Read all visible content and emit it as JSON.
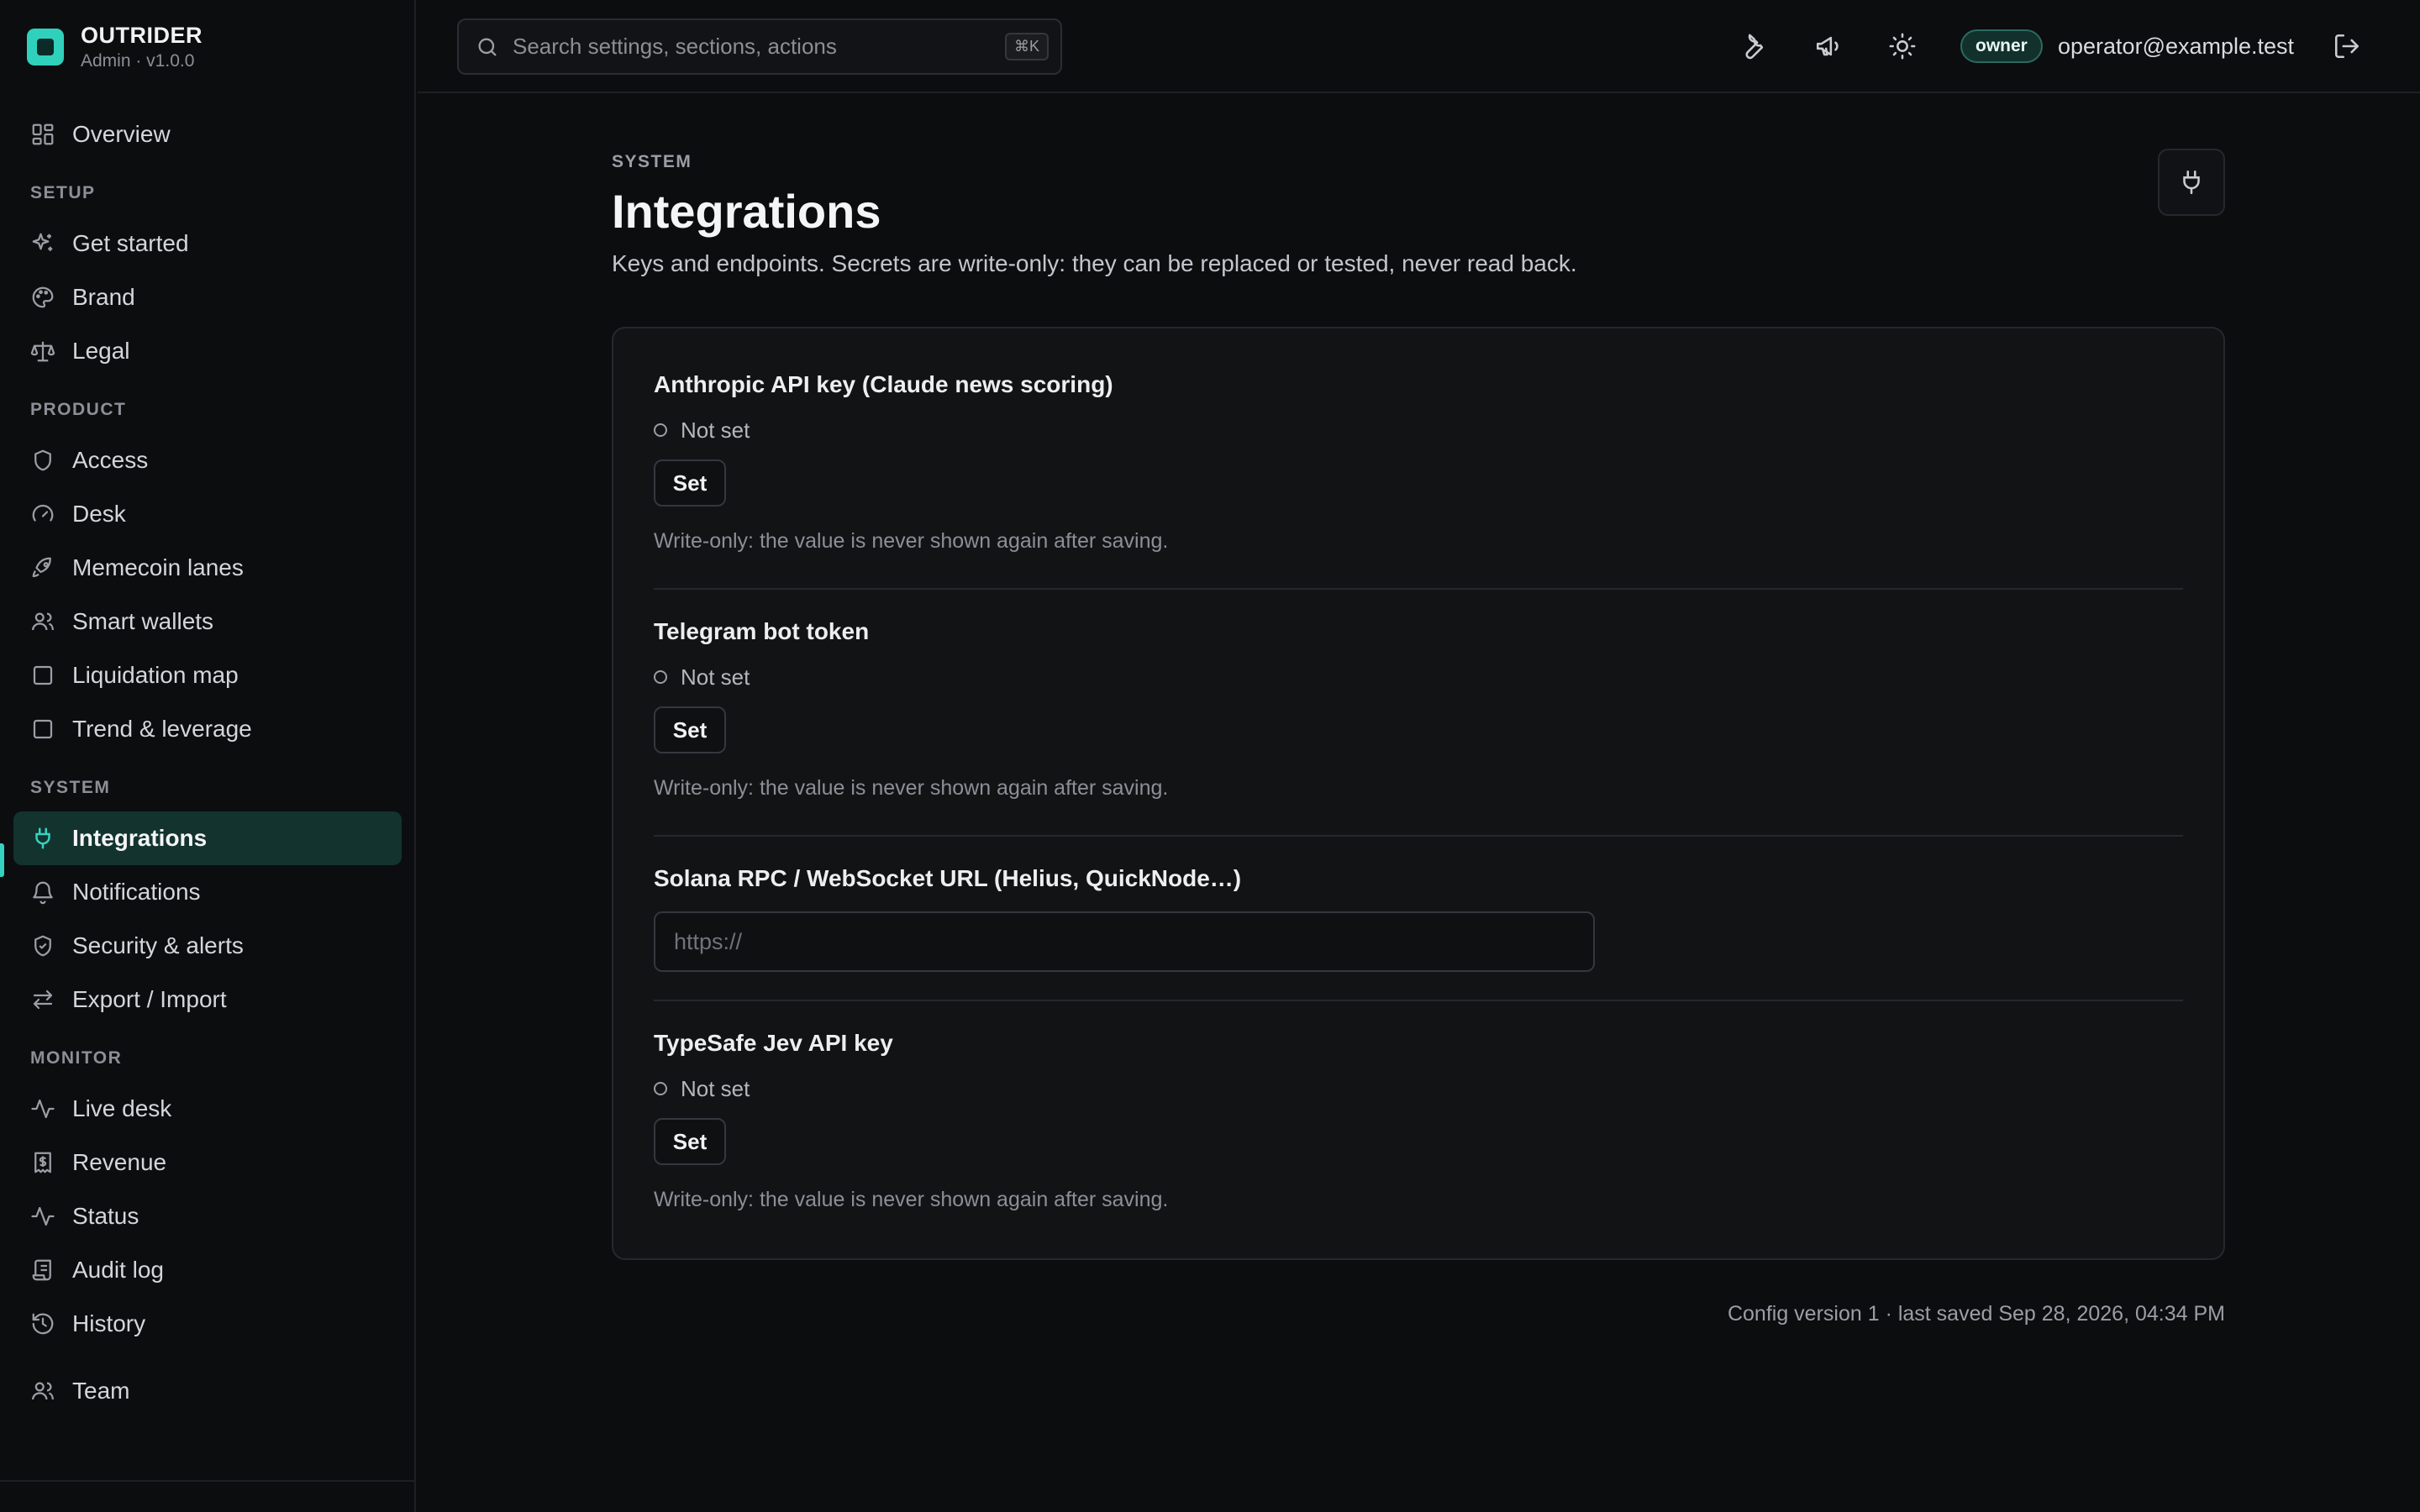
{
  "app": {
    "name": "OUTRIDER",
    "subtitle": "Admin · v1.0.0",
    "accent": "#35d3bf"
  },
  "sidebar": {
    "overview": "Overview",
    "groups": [
      {
        "label": "SETUP",
        "items": [
          {
            "label": "Get started",
            "icon": "sparkles-icon"
          },
          {
            "label": "Brand",
            "icon": "palette-icon"
          },
          {
            "label": "Legal",
            "icon": "scale-icon"
          }
        ]
      },
      {
        "label": "PRODUCT",
        "items": [
          {
            "label": "Access",
            "icon": "shield-icon"
          },
          {
            "label": "Desk",
            "icon": "gauge-icon"
          },
          {
            "label": "Memecoin lanes",
            "icon": "rocket-icon"
          },
          {
            "label": "Smart wallets",
            "icon": "users-icon"
          },
          {
            "label": "Liquidation map",
            "icon": "square-icon"
          },
          {
            "label": "Trend & leverage",
            "icon": "square-icon"
          }
        ]
      },
      {
        "label": "SYSTEM",
        "items": [
          {
            "label": "Integrations",
            "icon": "plug-icon",
            "active": true
          },
          {
            "label": "Notifications",
            "icon": "bell-icon"
          },
          {
            "label": "Security & alerts",
            "icon": "shield-check-icon"
          },
          {
            "label": "Export / Import",
            "icon": "arrows-swap-icon"
          }
        ]
      },
      {
        "label": "MONITOR",
        "items": [
          {
            "label": "Live desk",
            "icon": "activity-icon"
          },
          {
            "label": "Revenue",
            "icon": "receipt-icon"
          },
          {
            "label": "Status",
            "icon": "activity-icon"
          },
          {
            "label": "Audit log",
            "icon": "scroll-icon"
          },
          {
            "label": "History",
            "icon": "history-icon"
          }
        ]
      }
    ],
    "team": "Team"
  },
  "topbar": {
    "search_placeholder": "Search settings, sections, actions",
    "search_shortcut": "⌘K",
    "role": "owner",
    "email": "operator@example.test"
  },
  "page": {
    "breadcrumb": "SYSTEM",
    "title": "Integrations",
    "description": "Keys and endpoints. Secrets are write-only: they can be replaced or tested, never read back."
  },
  "integrations": [
    {
      "title": "Anthropic API key (Claude news scoring)",
      "status": "Not set",
      "button": "Set",
      "hint": "Write-only: the value is never shown again after saving."
    },
    {
      "title": "Telegram bot token",
      "status": "Not set",
      "button": "Set",
      "hint": "Write-only: the value is never shown again after saving."
    },
    {
      "title": "Solana RPC / WebSocket URL (Helius, QuickNode…)",
      "placeholder": "https://"
    },
    {
      "title": "TypeSafe Jev API key",
      "status": "Not set",
      "button": "Set",
      "hint": "Write-only: the value is never shown again after saving."
    }
  ],
  "footer": "Config version 1 · last saved Sep 28, 2026, 04:34 PM"
}
